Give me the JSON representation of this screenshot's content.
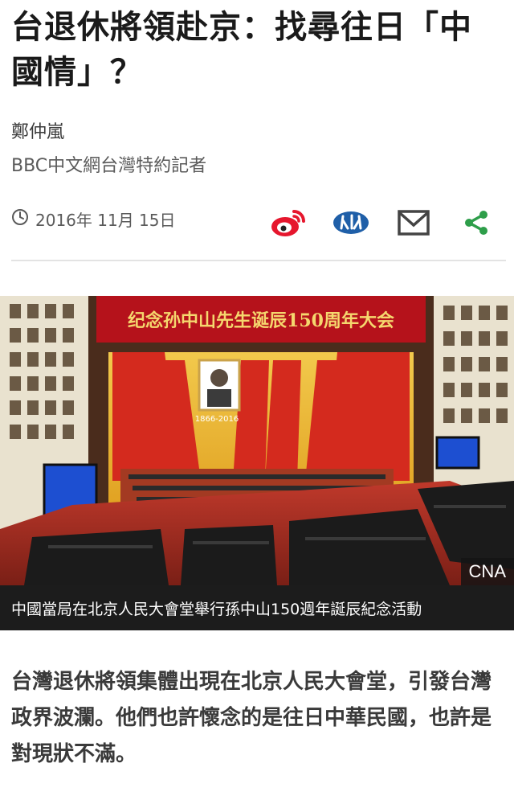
{
  "article": {
    "headline": "台退休將領赴京：找尋往日「中國情」？",
    "author": "鄭仲嵐",
    "author_role": "BBC中文網台灣特約記者",
    "date": "2016年 11月 15日",
    "lead": "台灣退休將領集體出現在北京人民大會堂，引發台灣政界波瀾。他們也許懷念的是往日中華民國，也許是對現狀不滿。"
  },
  "share": {
    "icons": [
      "weibo-icon",
      "renren-icon",
      "email-icon",
      "share-icon"
    ],
    "colors": {
      "weibo": "#e6162d",
      "renren": "#1f5fa8",
      "email": "#444444",
      "share": "#2e9e4a"
    }
  },
  "photo": {
    "banner_text": "纪念孙中山先生诞辰150周年大会",
    "portrait_years": "1866-2016",
    "credit": "CNA",
    "caption": "中國當局在北京人民大會堂舉行孫中山150週年誕辰紀念活動"
  }
}
